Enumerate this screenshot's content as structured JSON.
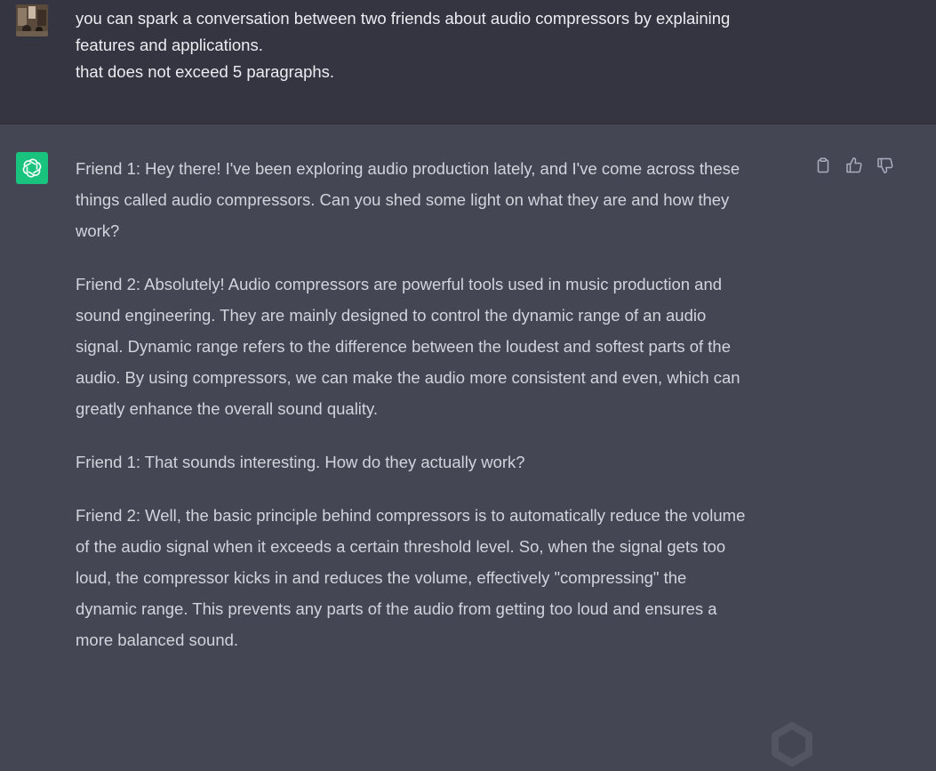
{
  "user_message": {
    "lines": [
      "you can spark a conversation between two friends about audio compressors by explaining",
      "features and applications.",
      "that does not exceed 5 paragraphs."
    ]
  },
  "assistant_message": {
    "paragraphs": [
      {
        "lines": [
          "Friend 1: Hey there! I've been exploring audio production lately, and I've come across these",
          "things called audio compressors. Can you shed some light on what they are and how they",
          "work?"
        ]
      },
      {
        "lines": [
          "Friend 2: Absolutely! Audio compressors are powerful tools used in music production and",
          "sound engineering. They are mainly designed to control the dynamic range of an audio",
          "signal. Dynamic range refers to the difference between the loudest and softest parts of the",
          "audio. By using compressors, we can make the audio more consistent and even, which can",
          "greatly enhance the overall sound quality."
        ]
      },
      {
        "lines": [
          "Friend 1: That sounds interesting. How do they actually work?"
        ]
      },
      {
        "lines": [
          "Friend 2: Well, the basic principle behind compressors is to automatically reduce the volume",
          "of the audio signal when it exceeds a certain threshold level. So, when the signal gets too",
          "loud, the compressor kicks in and reduces the volume, effectively \"compressing\" the",
          "dynamic range. This prevents any parts of the audio from getting too loud and ensures a",
          "more balanced sound."
        ]
      }
    ]
  },
  "actions": [
    {
      "name": "copy-icon"
    },
    {
      "name": "thumbs-up-icon"
    },
    {
      "name": "thumbs-down-icon"
    }
  ],
  "colors": {
    "user_bg": "#343541",
    "assistant_bg": "#444654",
    "gpt_avatar": "#19c37d"
  }
}
